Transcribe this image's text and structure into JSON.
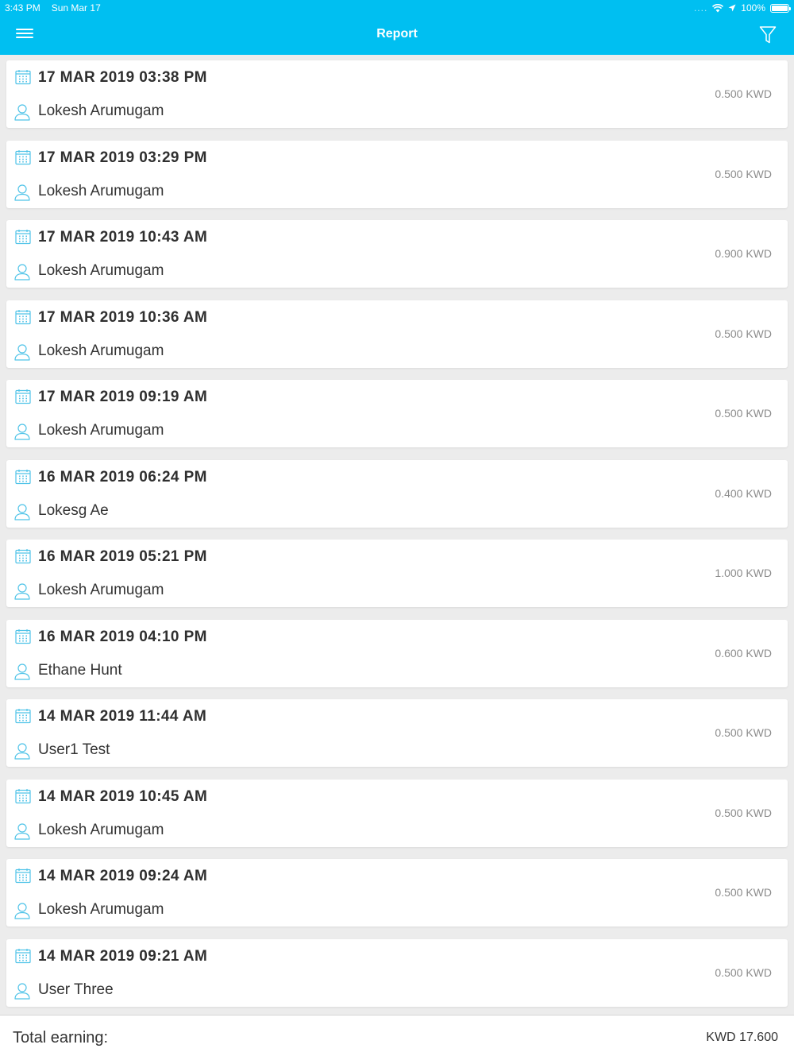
{
  "status_bar": {
    "time": "3:43 PM",
    "date": "Sun Mar 17",
    "signal": "....",
    "battery": "100%"
  },
  "nav": {
    "title": "Report",
    "menu_icon": "hamburger-menu-icon",
    "filter_icon": "filter-icon"
  },
  "colors": {
    "accent": "#00bff1",
    "icon": "#4fc3e8",
    "amount": "#8c8c8c"
  },
  "transactions": [
    {
      "date": "17 MAR 2019 03:38 PM",
      "name": "Lokesh Arumugam",
      "amount": "0.500 KWD"
    },
    {
      "date": "17 MAR 2019 03:29 PM",
      "name": "Lokesh Arumugam",
      "amount": "0.500 KWD"
    },
    {
      "date": "17 MAR 2019 10:43 AM",
      "name": "Lokesh Arumugam",
      "amount": "0.900 KWD"
    },
    {
      "date": "17 MAR 2019 10:36 AM",
      "name": "Lokesh Arumugam",
      "amount": "0.500 KWD"
    },
    {
      "date": "17 MAR 2019 09:19 AM",
      "name": "Lokesh Arumugam",
      "amount": "0.500 KWD"
    },
    {
      "date": "16 MAR 2019 06:24 PM",
      "name": "Lokesg Ae",
      "amount": "0.400 KWD"
    },
    {
      "date": "16 MAR 2019 05:21 PM",
      "name": "Lokesh Arumugam",
      "amount": "1.000 KWD"
    },
    {
      "date": "16 MAR 2019 04:10 PM",
      "name": "Ethane Hunt",
      "amount": "0.600 KWD"
    },
    {
      "date": "14 MAR 2019 11:44 AM",
      "name": "User1 Test",
      "amount": "0.500 KWD"
    },
    {
      "date": "14 MAR 2019 10:45 AM",
      "name": "Lokesh Arumugam",
      "amount": "0.500 KWD"
    },
    {
      "date": "14 MAR 2019 09:24 AM",
      "name": "Lokesh Arumugam",
      "amount": "0.500 KWD"
    },
    {
      "date": "14 MAR 2019 09:21 AM",
      "name": "User Three",
      "amount": "0.500 KWD"
    }
  ],
  "footer": {
    "label": "Total earning:",
    "total": "KWD 17.600"
  }
}
